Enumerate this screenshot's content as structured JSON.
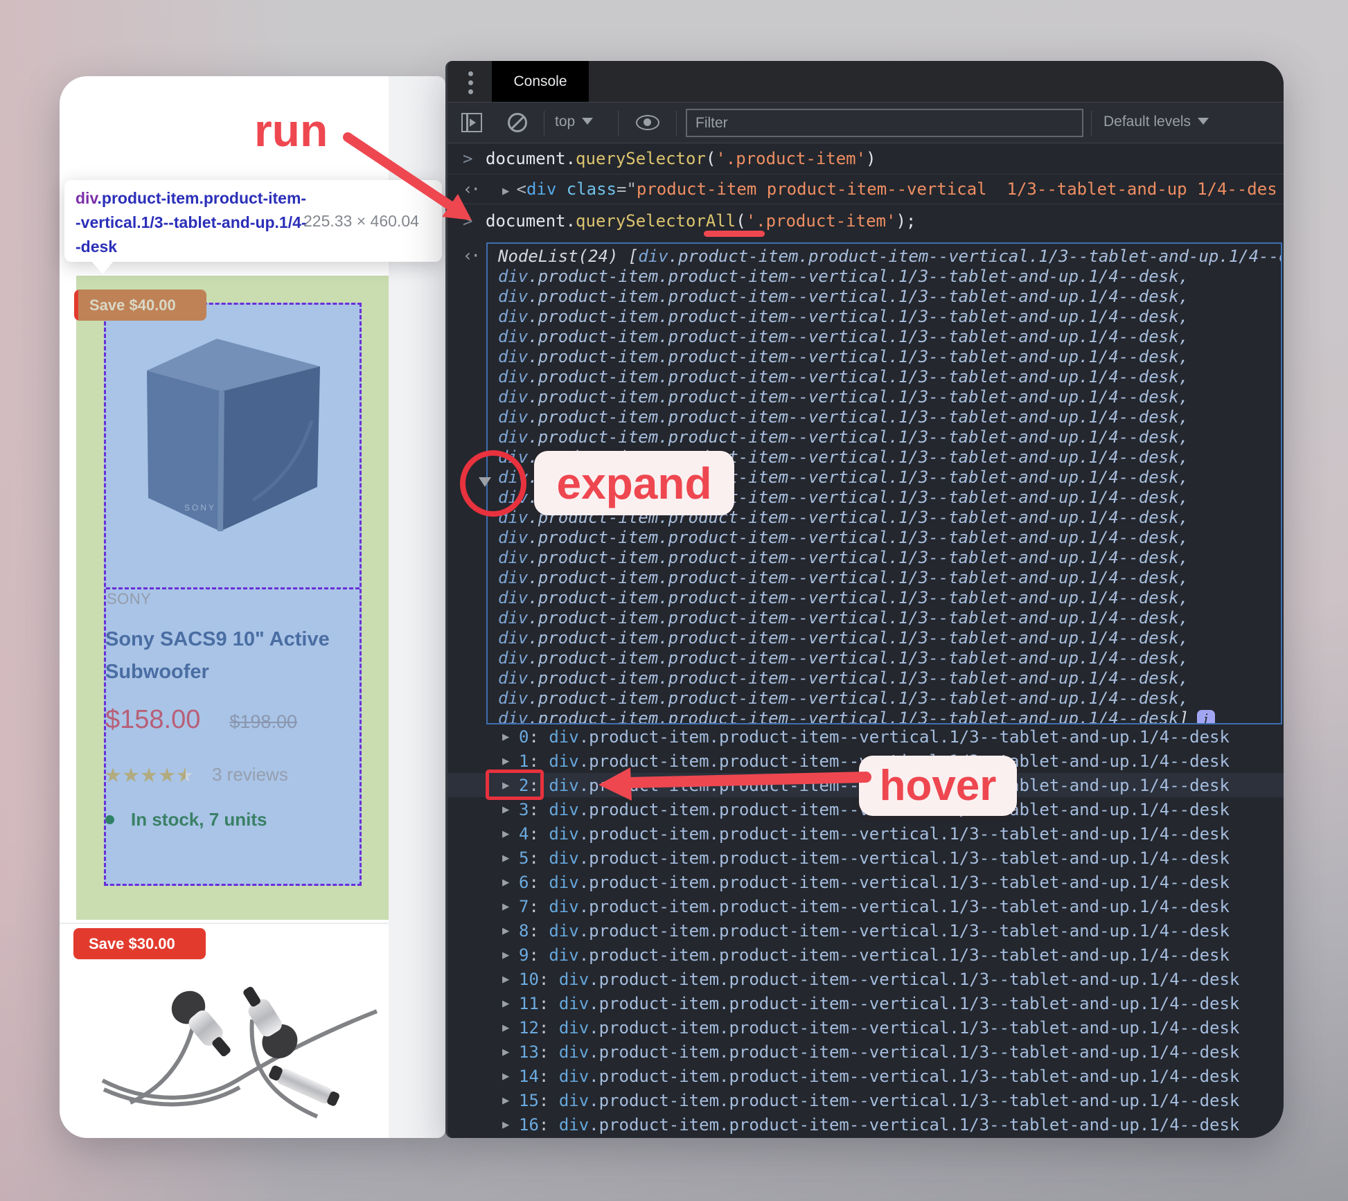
{
  "annotations": {
    "run_label": "run",
    "expand_label": "expand",
    "hover_label": "hover",
    "accent_color": "#ee4750"
  },
  "tooltip": {
    "tag": "div",
    "line1_rest": ".product-item.product-item--vertical.1/3--tablet-and-up.1/4--desk",
    "dimensions": "225.33 × 460.04"
  },
  "page": {
    "card1": {
      "badge": "Save $40.00",
      "image_logo": "SONY",
      "brand": "SONY",
      "title_line1": "Sony SACS9 10\" Active",
      "title_line2": "Subwoofer",
      "price": "$158.00",
      "old_price": "$198.00",
      "stars_full": "★★★★",
      "star_half": "★",
      "reviews": "3 reviews",
      "stock": "In stock, 7 units"
    },
    "card2": {
      "badge": "Save $30.00"
    }
  },
  "devtools": {
    "tab_label": "Console",
    "toolbar": {
      "context": "top",
      "filter_placeholder": "Filter",
      "levels_label": "Default levels"
    },
    "console": {
      "cmd1": {
        "pre": "document.",
        "method": "querySelector",
        "open": "(",
        "str": "'.product-item'",
        "close": ")"
      },
      "result1": {
        "lt": "<",
        "tag": "div",
        "attr": "class",
        "eq": "=\"",
        "val": "product-item product-item--vertical  1/3--tablet-and-up 1/4--des"
      },
      "cmd2": {
        "pre": "document.",
        "method": "querySelectorAll",
        "open": "(",
        "str": "'.product-item'",
        "close": ");"
      },
      "nodelist": {
        "label": "NodeList(24)",
        "open_bracket": "[",
        "entry_tag": "div",
        "entry_rest": ".product-item.product-item--vertical.1/3--tablet-and-up.1/4--desk",
        "separator": ",",
        "close_bracket": "]",
        "preview_line_count": 24,
        "info_glyph": "i"
      },
      "expanded": {
        "row_count": 17,
        "entry_tag": "div",
        "entry_rest": ".product-item.product-item--vertical.1/3--tablet-and-up.1/4--desk",
        "hover_index": 2
      }
    }
  }
}
